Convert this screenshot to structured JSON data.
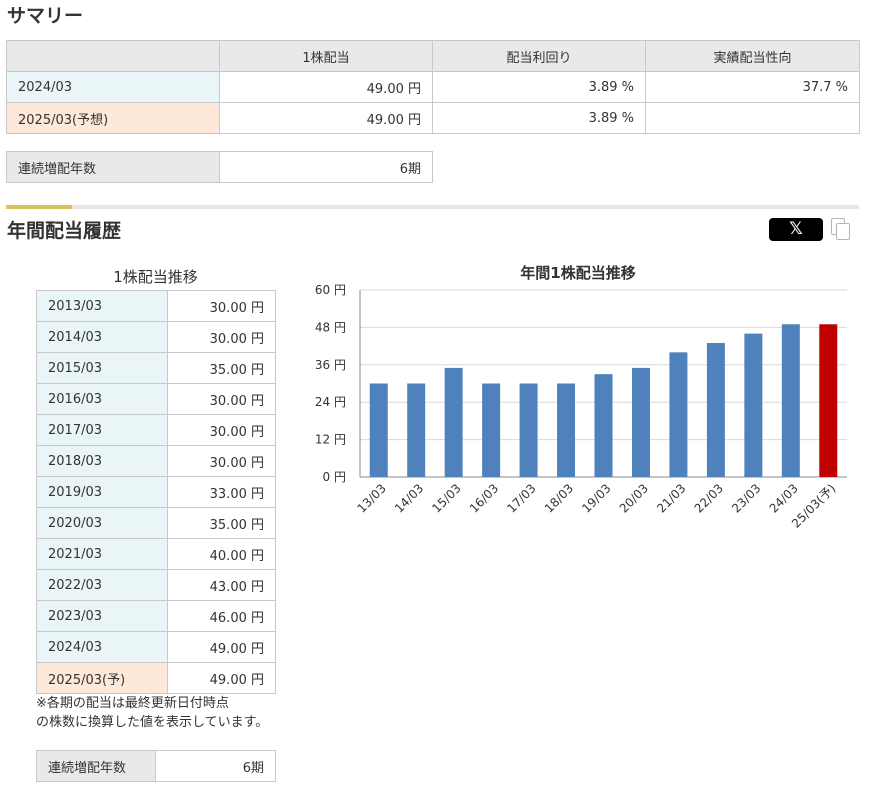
{
  "summary": {
    "title": "サマリー",
    "headers": [
      "",
      "1株配当",
      "配当利回り",
      "実績配当性向"
    ],
    "rows": [
      {
        "period": "2024/03",
        "dividend": "49.00 円",
        "yield": "3.89 %",
        "payout": "37.7 %",
        "type": "actual"
      },
      {
        "period": "2025/03(予想)",
        "dividend": "49.00 円",
        "yield": "3.89 %",
        "payout": "",
        "type": "forecast"
      }
    ],
    "streak_label": "連続増配年数",
    "streak_value": "6期"
  },
  "history": {
    "title": "年間配当履歴",
    "share_x_label": "𝕏",
    "table_caption": "1株配当推移",
    "rows": [
      {
        "period": "2013/03",
        "value": "30.00 円",
        "type": "actual"
      },
      {
        "period": "2014/03",
        "value": "30.00 円",
        "type": "actual"
      },
      {
        "period": "2015/03",
        "value": "35.00 円",
        "type": "actual"
      },
      {
        "period": "2016/03",
        "value": "30.00 円",
        "type": "actual"
      },
      {
        "period": "2017/03",
        "value": "30.00 円",
        "type": "actual"
      },
      {
        "period": "2018/03",
        "value": "30.00 円",
        "type": "actual"
      },
      {
        "period": "2019/03",
        "value": "33.00 円",
        "type": "actual"
      },
      {
        "period": "2020/03",
        "value": "35.00 円",
        "type": "actual"
      },
      {
        "period": "2021/03",
        "value": "40.00 円",
        "type": "actual"
      },
      {
        "period": "2022/03",
        "value": "43.00 円",
        "type": "actual"
      },
      {
        "period": "2023/03",
        "value": "46.00 円",
        "type": "actual"
      },
      {
        "period": "2024/03",
        "value": "49.00 円",
        "type": "actual"
      },
      {
        "period": "2025/03(予)",
        "value": "49.00 円",
        "type": "forecast"
      }
    ],
    "note_line1": "※各期の配当は最終更新日付時点",
    "note_line2": "の株数に換算した値を表示しています。",
    "streak_label": "連続増配年数",
    "streak_value": "6期"
  },
  "chart_data": {
    "type": "bar",
    "title": "年間1株配当推移",
    "categories": [
      "13/03",
      "14/03",
      "15/03",
      "16/03",
      "17/03",
      "18/03",
      "19/03",
      "20/03",
      "21/03",
      "22/03",
      "23/03",
      "24/03",
      "25/03(予)"
    ],
    "values": [
      30,
      30,
      35,
      30,
      30,
      30,
      33,
      35,
      40,
      43,
      46,
      49,
      49
    ],
    "ylim": [
      0,
      60
    ],
    "yticks": [
      0,
      12,
      24,
      36,
      48,
      60
    ],
    "ytick_labels": [
      "0 円",
      "12 円",
      "24 円",
      "36 円",
      "48 円",
      "60 円"
    ],
    "grid": true,
    "colors": {
      "actual": "#4f81bd",
      "forecast": "#c00000"
    }
  }
}
